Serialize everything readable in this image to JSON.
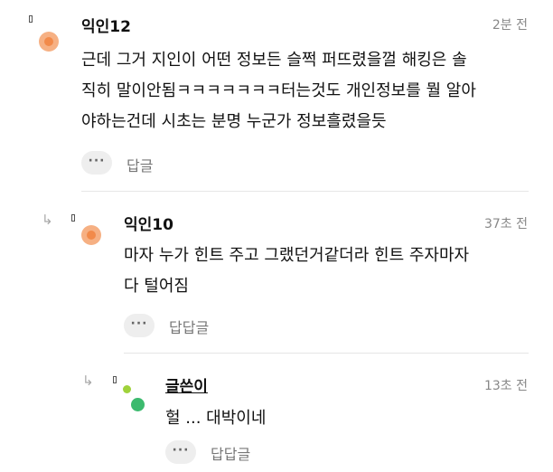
{
  "comments": [
    {
      "author": "익인12",
      "time": "2분 전",
      "lines": [
        "근데 그거 지인이 어떤 정보든 슬쩍 퍼뜨렸을껄 해킹은 솔",
        "직히 말이안됨ㅋㅋㅋㅋㅋㅋㅋ터는것도 개인정보를 뭘 알아",
        "야하는건데 시초는 분명 누군가 정보흘렸을듯"
      ],
      "more": "···",
      "reply_label": "답글"
    },
    {
      "author": "익인10",
      "time": "37초 전",
      "lines": [
        "마자 누가 힌트 주고 그랬던거같더라 힌트 주자마자",
        "다 털어짐"
      ],
      "more": "···",
      "reply_label": "답답글"
    },
    {
      "author": "글쓴이",
      "time": "13초 전",
      "lines": [
        "헐 ... 대박이네"
      ],
      "more": "···",
      "reply_label": "답답글"
    }
  ],
  "icons": {
    "reply_arrow": "↳"
  },
  "colors": {
    "avatar_orange": "#f28a4a",
    "avatar_green": "#3cba6e",
    "avatar_lime": "#9fd23b"
  }
}
